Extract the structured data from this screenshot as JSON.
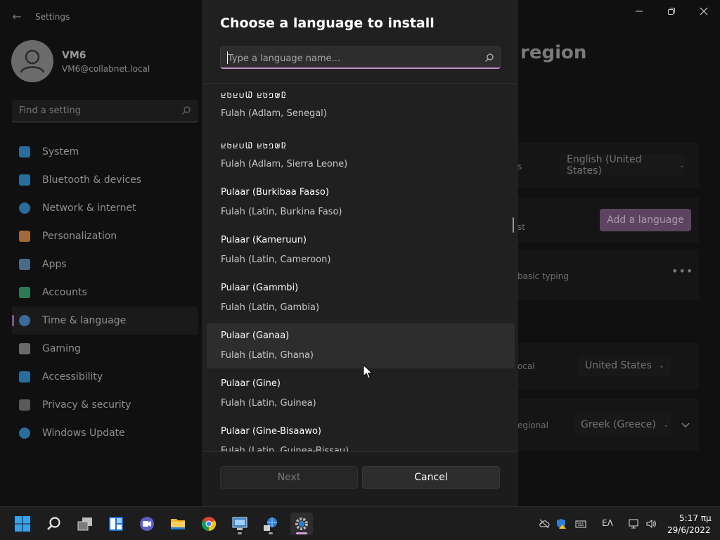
{
  "settings": {
    "app_title": "Settings",
    "profile": {
      "name": "VM6",
      "email": "VM6@collabnet.local"
    },
    "search_placeholder": "Find a setting",
    "nav": [
      {
        "label": "System",
        "icon": "system-icon",
        "color": "#2b6d9a"
      },
      {
        "label": "Bluetooth & devices",
        "icon": "bluetooth-icon",
        "color": "#2b6d9a"
      },
      {
        "label": "Network & internet",
        "icon": "wifi-icon",
        "color": "#2b6d9a"
      },
      {
        "label": "Personalization",
        "icon": "brush-icon",
        "color": "#a06a3a"
      },
      {
        "label": "Apps",
        "icon": "apps-icon",
        "color": "#4a6a8a"
      },
      {
        "label": "Accounts",
        "icon": "accounts-icon",
        "color": "#2f7a55"
      },
      {
        "label": "Time & language",
        "icon": "globe-clock-icon",
        "color": "#3a6a9a",
        "active": true
      },
      {
        "label": "Gaming",
        "icon": "gamepad-icon",
        "color": "#6a6a6a"
      },
      {
        "label": "Accessibility",
        "icon": "accessibility-icon",
        "color": "#2b6d9a"
      },
      {
        "label": "Privacy & security",
        "icon": "shield-icon",
        "color": "#5a5a5a"
      },
      {
        "label": "Windows Update",
        "icon": "windows-update-icon",
        "color": "#2b6d9a"
      }
    ],
    "page_title_fragment": "region",
    "display_language_value": "English (United States)",
    "partial_label_ist": "st",
    "add_language_label": "Add a language",
    "basic_typing_fragment": "basic typing",
    "more_label": "•••",
    "country_label_fragment": "ocal",
    "country_value": "United States",
    "regional_label_fragment": "egional",
    "regional_value": "Greek (Greece)",
    "is_fragment": "s"
  },
  "dialog": {
    "title": "Choose a language to install",
    "search_placeholder": "Type a language name...",
    "languages": [
      {
        "native": "𞤆𞤵𞤤𞤢𞤪 𞤅𞤭𞤪𞤢𞤪",
        "english": "Fulah (Adlam, Senegal)",
        "adlam": true
      },
      {
        "native": "𞤆𞤵𞤤𞤢𞤪 𞤅𞤭𞤪𞤢𞤪",
        "english": "Fulah (Adlam, Sierra Leone)",
        "adlam": true
      },
      {
        "native": "Pulaar (Burkibaa Faaso)",
        "english": "Fulah (Latin, Burkina Faso)"
      },
      {
        "native": "Pulaar (Kameruun)",
        "english": "Fulah (Latin, Cameroon)"
      },
      {
        "native": "Pulaar (Gammbi)",
        "english": "Fulah (Latin, Gambia)"
      },
      {
        "native": "Pulaar (Ganaa)",
        "english": "Fulah (Latin, Ghana)",
        "hover": true
      },
      {
        "native": "Pulaar (Gine)",
        "english": "Fulah (Latin, Guinea)"
      },
      {
        "native": "Pulaar (Gine-Bisaawo)",
        "english": "Fulah (Latin, Guinea-Bissau)"
      }
    ],
    "next_label": "Next",
    "cancel_label": "Cancel"
  },
  "taskbar": {
    "apps": [
      "start-icon",
      "search-icon",
      "task-view-icon",
      "widgets-icon",
      "teams-chat-icon",
      "file-explorer-icon",
      "chrome-icon",
      "remote-desktop-icon",
      "network-tool-icon",
      "settings-icon"
    ],
    "input_language": "ΕΛ",
    "time": "5:17 πμ",
    "date": "29/6/2022"
  },
  "colors": {
    "accent": "#c98fcf",
    "active_indicator": "#d49fda",
    "dialog_bg": "#202020",
    "hover_row": "#2d2d2d"
  }
}
